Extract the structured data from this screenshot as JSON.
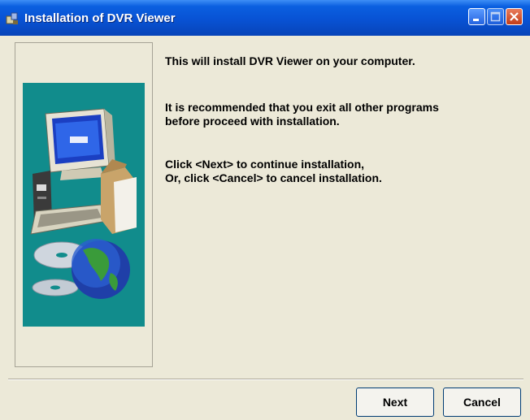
{
  "window": {
    "title": "Installation of DVR Viewer",
    "title_icon": "installer-icon",
    "controls": [
      "minimize-icon",
      "maximize-icon",
      "close-icon"
    ]
  },
  "content": {
    "line1": "This will install DVR Viewer on your computer.",
    "line2": "It is recommended that you exit all other programs\nbefore proceed with installation.",
    "line3": "Click <Next> to continue installation,\nOr, click <Cancel> to cancel installation."
  },
  "buttons": {
    "next": "Next",
    "cancel": "Cancel"
  },
  "colors": {
    "title_bar": "#0852d4",
    "illustration_bg": "#118c8c",
    "dialog_bg": "#ece9d8"
  }
}
